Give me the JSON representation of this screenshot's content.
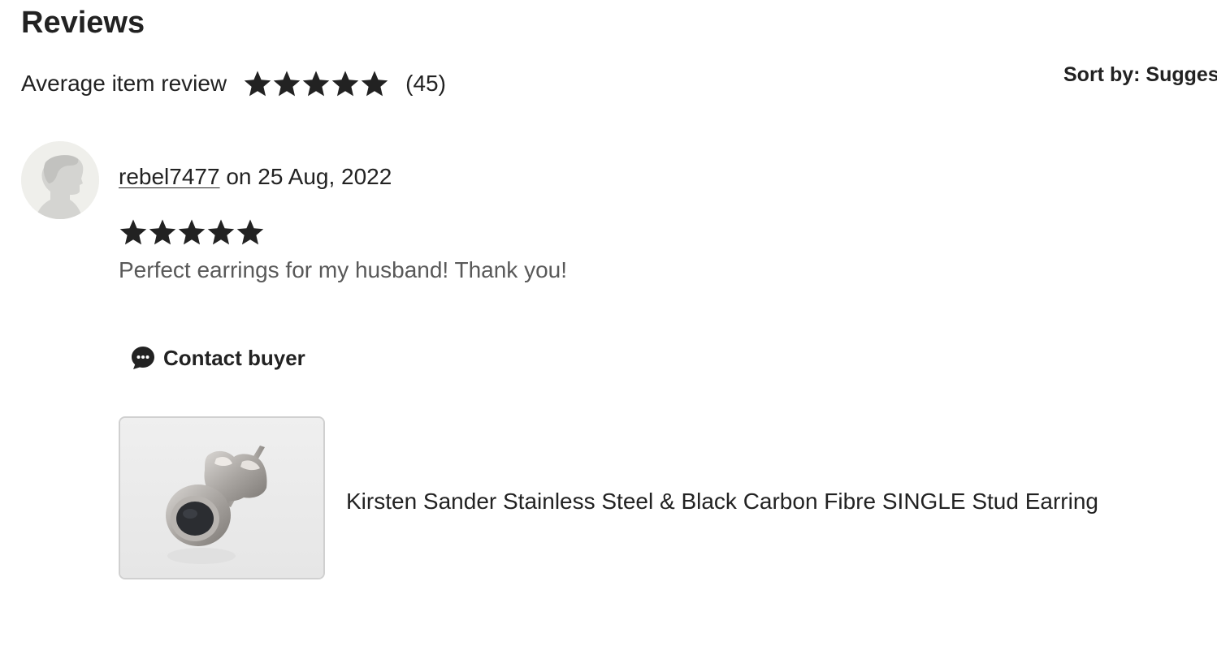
{
  "reviews": {
    "title": "Reviews",
    "average_label": "Average item review",
    "average_rating": 5,
    "review_count": "(45)",
    "sort_label": "Sort by: Sugges"
  },
  "review": {
    "username": "rebel7477",
    "date_text": " on 25 Aug, 2022",
    "rating": 5,
    "text": "Perfect earrings for my husband! Thank you!",
    "contact_label": "Contact buyer",
    "product_title": "Kirsten Sander Stainless Steel & Black Carbon Fibre SINGLE Stud Earring"
  },
  "icons": {
    "star": "star-icon",
    "contact": "chat-bubble-icon",
    "avatar": "default-avatar-icon"
  },
  "colors": {
    "text": "#222222",
    "muted_text": "#595959",
    "star": "#222222",
    "avatar_bg": "#eeeeea"
  }
}
